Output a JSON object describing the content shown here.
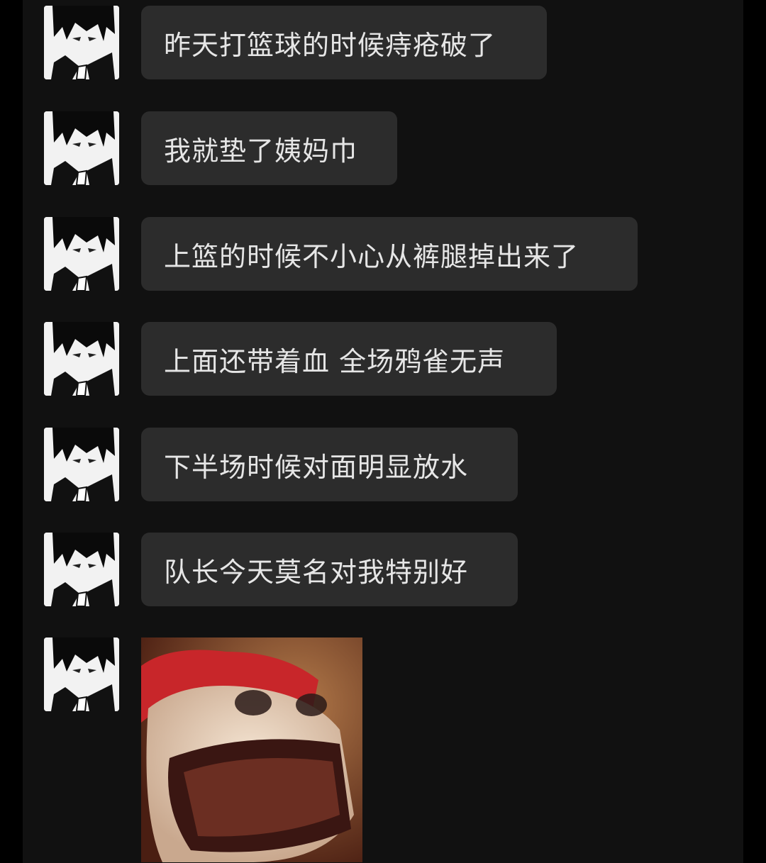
{
  "chat": {
    "messages": [
      {
        "sender": "avatar",
        "text": "昨天打篮球的时候痔疮破了"
      },
      {
        "sender": "avatar",
        "text": "我就垫了姨妈巾"
      },
      {
        "sender": "avatar",
        "text": "上篮的时候不小心从裤腿掉出来了"
      },
      {
        "sender": "avatar",
        "text": "上面还带着血 全场鸦雀无声"
      },
      {
        "sender": "avatar",
        "text": "下半场时候对面明显放水"
      },
      {
        "sender": "avatar",
        "text": "队长今天莫名对我特别好"
      }
    ],
    "sticker": {
      "icon": "screaming-face-sticker"
    }
  },
  "colors": {
    "background": "#000000",
    "panel": "#111111",
    "bubble": "#2c2c2c",
    "bubble_text": "#e6e6e6"
  }
}
